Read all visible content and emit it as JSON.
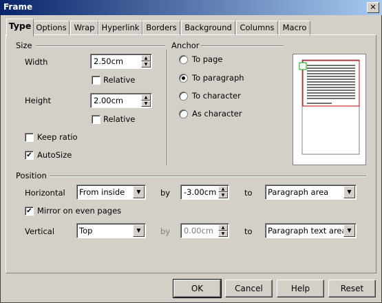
{
  "window": {
    "title": "Frame",
    "close_glyph": "✕"
  },
  "tabs": [
    {
      "label": "Type",
      "active": true
    },
    {
      "label": "Options"
    },
    {
      "label": "Wrap"
    },
    {
      "label": "Hyperlink"
    },
    {
      "label": "Borders"
    },
    {
      "label": "Background"
    },
    {
      "label": "Columns"
    },
    {
      "label": "Macro"
    }
  ],
  "size": {
    "group_label": "Size",
    "width_label": "Width",
    "width_value": "2.50cm",
    "width_relative_label": "Relative",
    "height_label": "Height",
    "height_value": "2.00cm",
    "height_relative_label": "Relative",
    "keep_ratio_label": "Keep ratio",
    "keep_ratio_checked": false,
    "autosize_label": "AutoSize",
    "autosize_checked": true
  },
  "anchor": {
    "group_label": "Anchor",
    "options": [
      {
        "label": "To page",
        "selected": false
      },
      {
        "label": "To paragraph",
        "selected": true
      },
      {
        "label": "To character",
        "selected": false
      },
      {
        "label": "As character",
        "selected": false
      }
    ]
  },
  "position": {
    "group_label": "Position",
    "horizontal_label": "Horizontal",
    "horizontal_value": "From inside",
    "h_by_label": "by",
    "h_by_value": "-3.00cm",
    "h_to_label": "to",
    "h_to_value": "Paragraph area",
    "mirror_label": "Mirror on even pages",
    "mirror_checked": true,
    "vertical_label": "Vertical",
    "vertical_value": "Top",
    "v_by_label": "by",
    "v_by_value": "0.00cm",
    "v_to_label": "to",
    "v_to_value": "Paragraph text area"
  },
  "buttons": {
    "ok": "OK",
    "cancel": "Cancel",
    "help": "Help",
    "reset": "Reset"
  },
  "colors": {
    "dialog_bg": "#d4d0c8",
    "titlebar_start": "#0a246a",
    "preview_frame": "#cc0000",
    "preview_anchor": "#00aa00"
  }
}
